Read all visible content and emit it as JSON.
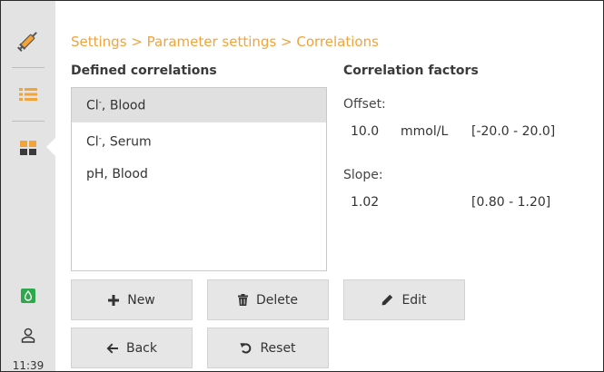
{
  "colors": {
    "accent": "#f2a33a",
    "sidebar_bg": "#e3e3e3",
    "selected_row": "#e0e0e0",
    "green": "#2ea84a"
  },
  "sidebar": {
    "icons": [
      "syringe-icon",
      "list-icon",
      "grid-icon",
      "drop-icon",
      "user-icon"
    ],
    "time": "11:39"
  },
  "breadcrumb": "Settings > Parameter settings > Correlations",
  "defined": {
    "title": "Defined correlations",
    "items": [
      {
        "main": "Cl",
        "sup": "-",
        "rest": ", Blood"
      },
      {
        "main": "Cl",
        "sup": "-",
        "rest": ", Serum"
      },
      {
        "main": "pH, Blood",
        "sup": "",
        "rest": ""
      }
    ]
  },
  "factors": {
    "title": "Correlation factors",
    "offset_label": "Offset:",
    "offset_value": "10.0",
    "offset_unit": "mmol/L",
    "offset_range": "[-20.0 - 20.0]",
    "slope_label": "Slope:",
    "slope_value": "1.02",
    "slope_range": "[0.80 - 1.20]"
  },
  "buttons": {
    "new": "New",
    "delete": "Delete",
    "edit": "Edit",
    "back": "Back",
    "reset": "Reset"
  }
}
